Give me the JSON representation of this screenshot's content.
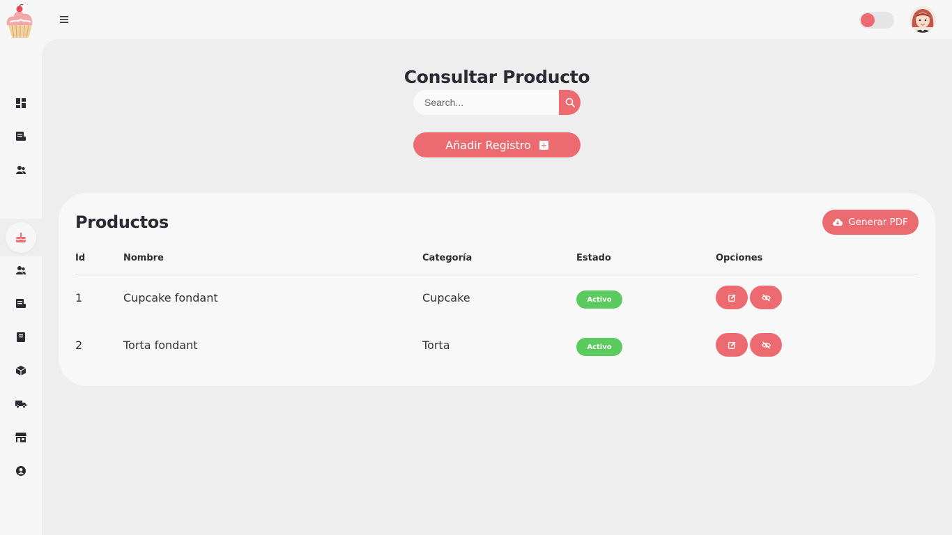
{
  "header": {
    "logo_icon": "cupcake-logo-icon",
    "menu_icon": "hamburger-menu-icon",
    "theme_toggle_on": true,
    "avatar_icon": "user-avatar-icon"
  },
  "sidebar": {
    "items": [
      {
        "icon": "dashboard-icon"
      },
      {
        "icon": "report-icon"
      },
      {
        "icon": "users-icon"
      },
      {
        "icon": "cake-icon",
        "active": true
      },
      {
        "icon": "users-icon"
      },
      {
        "icon": "report-icon"
      },
      {
        "icon": "book-icon"
      },
      {
        "icon": "box-icon"
      },
      {
        "icon": "truck-icon"
      },
      {
        "icon": "store-icon"
      },
      {
        "icon": "user-circle-icon"
      }
    ]
  },
  "main": {
    "title": "Consultar Producto",
    "search": {
      "placeholder": "Search...",
      "value": ""
    },
    "add_label": "Añadir Registro"
  },
  "products": {
    "title": "Productos",
    "pdf_label": "Generar PDF",
    "columns": [
      "Id",
      "Nombre",
      "Categoría",
      "Estado",
      "Opciones"
    ],
    "rows": [
      {
        "id": "1",
        "name": "Cupcake fondant",
        "category": "Cupcake",
        "status": "Activo"
      },
      {
        "id": "2",
        "name": "Torta fondant",
        "category": "Torta",
        "status": "Activo"
      }
    ]
  },
  "colors": {
    "accent": "#ec6b70",
    "active_badge": "#5ccb5f",
    "background": "#eeeeee",
    "surface": "#f8f8f8"
  }
}
